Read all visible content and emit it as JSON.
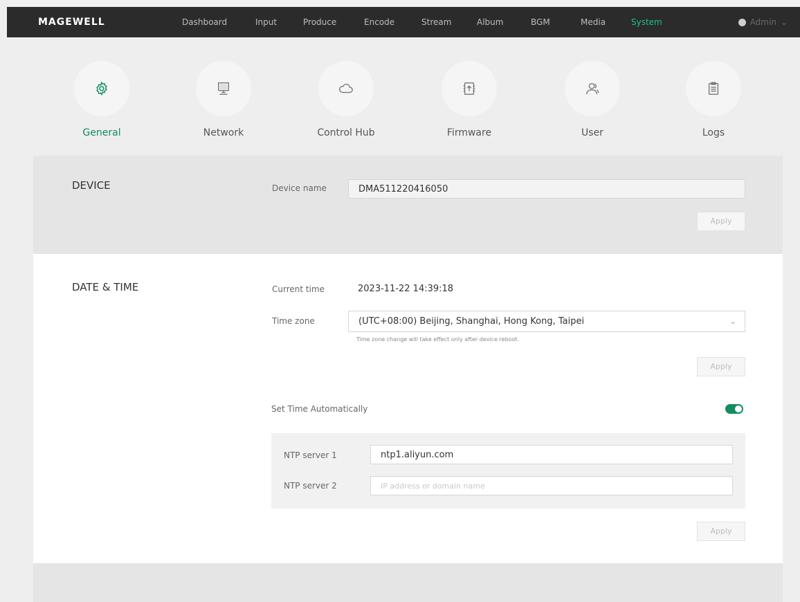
{
  "brand": "MAGEWELL",
  "nav": {
    "items": [
      "Dashboard",
      "Input",
      "Produce",
      "Encode",
      "Stream",
      "Album",
      "BGM",
      "Media",
      "System"
    ],
    "active": "System",
    "user_label": "Admin"
  },
  "categories": {
    "items": [
      "General",
      "Network",
      "Control Hub",
      "Firmware",
      "User",
      "Logs"
    ],
    "icons": [
      "gear-icon",
      "monitor-icon",
      "cloud-icon",
      "firmware-icon",
      "user-icon",
      "clipboard-icon"
    ],
    "active": "General"
  },
  "device": {
    "title": "DEVICE",
    "name_label": "Device name",
    "name_value": "DMA511220416050",
    "apply_label": "Apply"
  },
  "datetime": {
    "title": "DATE & TIME",
    "current_time_label": "Current time",
    "current_time_value": "2023-11-22 14:39:18",
    "timezone_label": "Time zone",
    "timezone_value": "(UTC+08:00) Beijing, Shanghai, Hong Kong, Taipei",
    "timezone_hint": "Time zone change will take effect only after device reboot.",
    "apply_label": "Apply",
    "auto_label": "Set Time Automatically",
    "auto_enabled": true,
    "ntp1_label": "NTP server 1",
    "ntp1_value": "ntp1.aliyun.com",
    "ntp2_label": "NTP server 2",
    "ntp2_placeholder": "IP address or domain name",
    "apply2_label": "Apply"
  },
  "colors": {
    "accent": "#128d60",
    "active_nav": "#1fbf8f",
    "topbar": "#2b2b2b"
  }
}
